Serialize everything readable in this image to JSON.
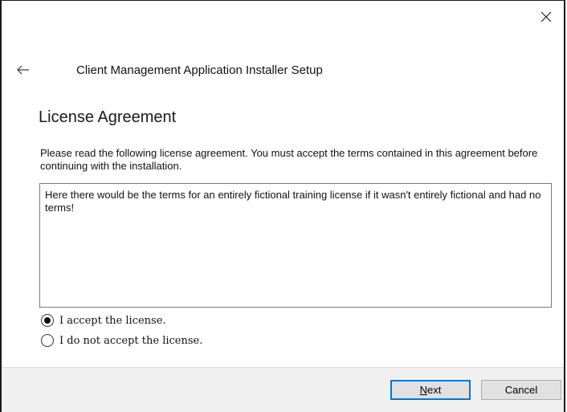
{
  "window": {
    "title": "Client Management Application Installer Setup",
    "close_icon": "close-icon",
    "back_icon": "back-arrow-icon"
  },
  "page": {
    "heading": "License Agreement",
    "description": "Please read the following license agreement. You must accept the terms contained in this agreement before continuing with the installation.",
    "license_text": "Here there would be the terms for an entirely fictional training license if it wasn't entirely fictional and had no terms!"
  },
  "options": {
    "accept_label": "I accept the license.",
    "accept_selected": true,
    "decline_label": "I do not accept the license.",
    "decline_selected": false
  },
  "buttons": {
    "next_mnemonic": "N",
    "next_rest": "ext",
    "cancel_label": "Cancel"
  },
  "colors": {
    "accent": "#0078d7",
    "footer_bg": "#f0f0f0"
  }
}
